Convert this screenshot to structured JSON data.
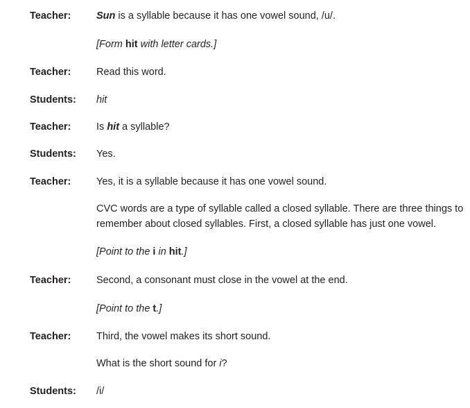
{
  "lines": [
    {
      "speaker": "Teacher:",
      "parts": [
        {
          "t": "Sun",
          "s": "bi"
        },
        {
          "t": " is a syllable because it has one vowel sound, /u/.",
          "s": ""
        }
      ]
    },
    {
      "speaker": "",
      "parts": [
        {
          "t": "[Form ",
          "s": "i"
        },
        {
          "t": "hit",
          "s": "b"
        },
        {
          "t": " with letter cards.]",
          "s": "i"
        }
      ]
    },
    {
      "speaker": "Teacher:",
      "parts": [
        {
          "t": "Read this word.",
          "s": ""
        }
      ]
    },
    {
      "speaker": "Students:",
      "parts": [
        {
          "t": "hit",
          "s": "i"
        }
      ]
    },
    {
      "speaker": "Teacher:",
      "parts": [
        {
          "t": "Is ",
          "s": ""
        },
        {
          "t": "hit",
          "s": "bi"
        },
        {
          "t": " a syllable?",
          "s": ""
        }
      ]
    },
    {
      "speaker": "Students:",
      "parts": [
        {
          "t": "Yes.",
          "s": ""
        }
      ]
    },
    {
      "speaker": "Teacher:",
      "parts": [
        {
          "t": "Yes, it is a syllable because it has one vowel sound.",
          "s": ""
        }
      ]
    },
    {
      "speaker": "",
      "parts": [
        {
          "t": "CVC words are a type of syllable called a closed syllable. There are three things to remember about closed syllables. First, a closed syllable has just one vowel.",
          "s": ""
        }
      ]
    },
    {
      "speaker": "",
      "parts": [
        {
          "t": "[Point to the ",
          "s": "i"
        },
        {
          "t": "i",
          "s": "b"
        },
        {
          "t": " in ",
          "s": "i"
        },
        {
          "t": "hit",
          "s": "b"
        },
        {
          "t": ".]",
          "s": "i"
        }
      ]
    },
    {
      "speaker": "Teacher:",
      "parts": [
        {
          "t": "Second, a consonant must close in the vowel at the end.",
          "s": ""
        }
      ]
    },
    {
      "speaker": "",
      "parts": [
        {
          "t": "[Point to the ",
          "s": "i"
        },
        {
          "t": "t",
          "s": "b"
        },
        {
          "t": ".]",
          "s": "i"
        }
      ]
    },
    {
      "speaker": "Teacher:",
      "parts": [
        {
          "t": "Third, the vowel makes its short sound.",
          "s": ""
        }
      ]
    },
    {
      "speaker": "",
      "parts": [
        {
          "t": "What is the short sound for ",
          "s": ""
        },
        {
          "t": "i",
          "s": "i"
        },
        {
          "t": "?",
          "s": ""
        }
      ]
    },
    {
      "speaker": "Students:",
      "parts": [
        {
          "t": "/i/",
          "s": ""
        }
      ]
    }
  ]
}
